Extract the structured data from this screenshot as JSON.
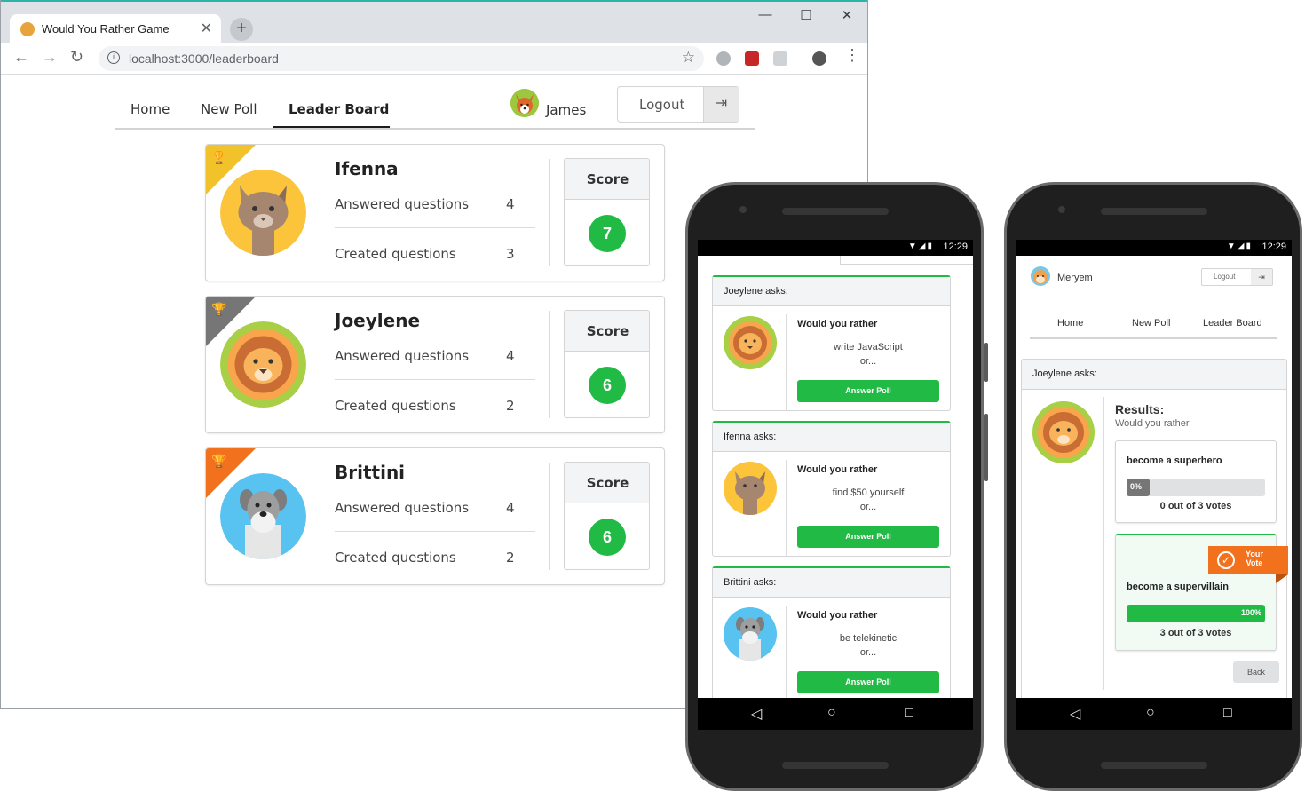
{
  "browser": {
    "tab_title": "Would You Rather Game",
    "tab_close": "✕",
    "new_tab": "+",
    "url": "localhost:3000/leaderboard",
    "controls": {
      "minimize": "—",
      "maximize": "☐",
      "close": "✕"
    }
  },
  "app": {
    "nav": {
      "home": "Home",
      "new_poll": "New Poll",
      "leader_board": "Leader Board"
    },
    "user": {
      "name": "James"
    },
    "logout_label": "Logout",
    "logout_icon": "sign-out-icon",
    "leaderboard": [
      {
        "name": "Ifenna",
        "answered_label": "Answered questions",
        "answered": "4",
        "created_label": "Created questions",
        "created": "3",
        "score_label": "Score",
        "score": "7",
        "ribbon_color": "#f2c22a",
        "avatar": "cat-icon"
      },
      {
        "name": "Joeylene",
        "answered_label": "Answered questions",
        "answered": "4",
        "created_label": "Created questions",
        "created": "2",
        "score_label": "Score",
        "score": "6",
        "ribbon_color": "#767676",
        "avatar": "lion-icon"
      },
      {
        "name": "Brittini",
        "answered_label": "Answered questions",
        "answered": "4",
        "created_label": "Created questions",
        "created": "2",
        "score_label": "Score",
        "score": "6",
        "ribbon_color": "#f2711c",
        "avatar": "dog-icon"
      }
    ]
  },
  "phone1": {
    "time": "12:29",
    "polls": [
      {
        "asker": "Joeylene asks:",
        "heading": "Would you rather",
        "option": "write JavaScript",
        "or": "or...",
        "button": "Answer Poll"
      },
      {
        "asker": "Ifenna asks:",
        "heading": "Would you rather",
        "option": "find $50 yourself",
        "or": "or...",
        "button": "Answer Poll"
      },
      {
        "asker": "Brittini asks:",
        "heading": "Would you rather",
        "option": "be telekinetic",
        "or": "or...",
        "button": "Answer Poll"
      }
    ]
  },
  "phone2": {
    "time": "12:29",
    "user": "Meryem",
    "logout": "Logout",
    "nav": {
      "home": "Home",
      "new_poll": "New Poll",
      "leader_board": "Leader Board"
    },
    "asker": "Joeylene asks:",
    "results_title": "Results:",
    "heading": "Would you rather",
    "options": [
      {
        "text": "become a superhero",
        "percent_label": "0%",
        "percent": 0,
        "votes": "0 out of 3 votes"
      },
      {
        "text": "become a supervillain",
        "percent_label": "100%",
        "percent": 100,
        "votes": "3 out of 3 votes",
        "your_vote": "Your\nVote"
      }
    ],
    "back": "Back"
  },
  "colors": {
    "accent_green": "#21ba45",
    "gold": "#f2c22a",
    "silver": "#767676",
    "bronze": "#f2711c"
  }
}
